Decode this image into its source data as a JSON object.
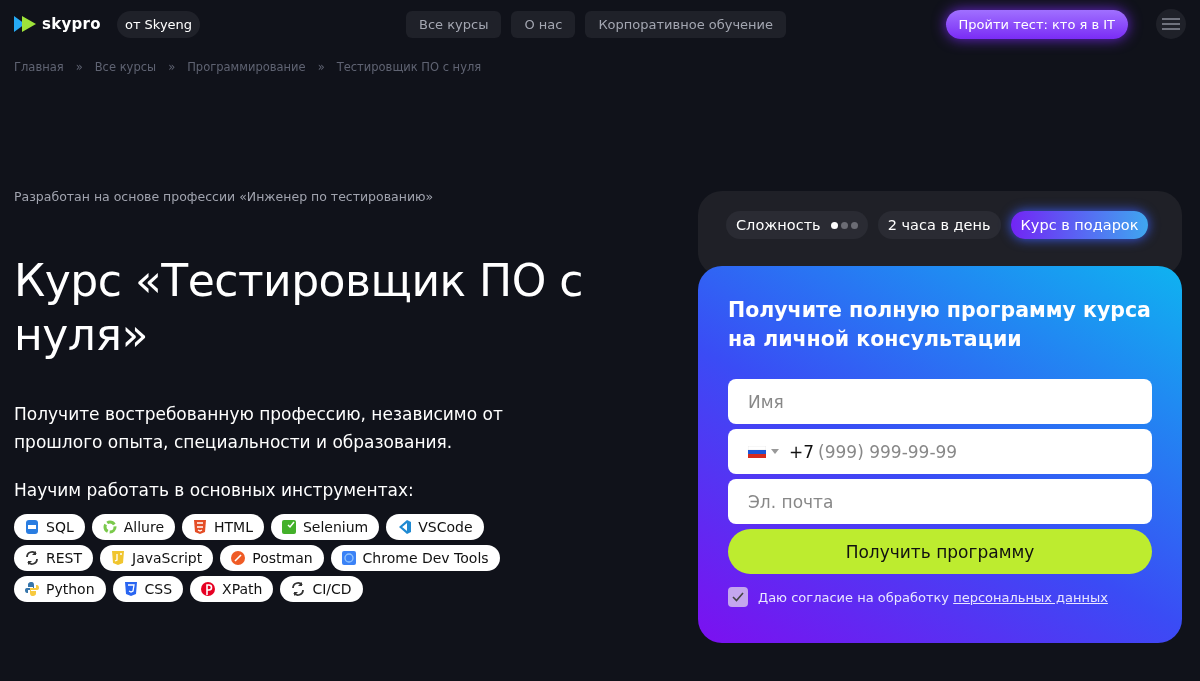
{
  "header": {
    "logo": "skypro",
    "logo_badge": "от Skyeng",
    "nav": [
      "Все курсы",
      "О нас",
      "Корпоративное обучение"
    ],
    "cta": "Пройти тест: кто я в IT"
  },
  "breadcrumbs": [
    "Главная",
    "Все курсы",
    "Программирование",
    "Тестировщик ПО с нуля"
  ],
  "breadcrumb_separator": "»",
  "hero": {
    "eyebrow": "Разработан на основе профессии «Инженер по тестированию»",
    "title": "Курс «Тестировщик ПО с нуля»",
    "subtitle": "Получите востребованную профессию, независимо от прошлого опыта, специальности и образования.",
    "tools_heading": "Научим работать в основных инструментах:",
    "tools": [
      {
        "label": "SQL",
        "kind": "sql"
      },
      {
        "label": "Allure",
        "kind": "allure"
      },
      {
        "label": "HTML",
        "kind": "html"
      },
      {
        "label": "Selenium",
        "kind": "selenium"
      },
      {
        "label": "VSCode",
        "kind": "vscode"
      },
      {
        "label": "REST",
        "kind": "cycle"
      },
      {
        "label": "JavaScript",
        "kind": "js"
      },
      {
        "label": "Postman",
        "kind": "postman"
      },
      {
        "label": "Chrome Dev Tools",
        "kind": "chrome"
      },
      {
        "label": "Python",
        "kind": "python"
      },
      {
        "label": "CSS",
        "kind": "css"
      },
      {
        "label": "XPath",
        "kind": "xpath"
      },
      {
        "label": "CI/CD",
        "kind": "cycle"
      }
    ]
  },
  "facts": {
    "difficulty_label": "Сложность",
    "stars": 1,
    "hours": "2 часа в день",
    "gift": "Курс в подарок"
  },
  "form": {
    "title": "Получите полную программу курса на личной консультации",
    "name": {
      "placeholder": "Имя"
    },
    "phone": {
      "prefix": "+7",
      "placeholder": "(999) 999-99-99"
    },
    "email": {
      "placeholder": "Эл. почта"
    },
    "submit": "Получить программу",
    "consent": {
      "checked": true,
      "text": "Даю согласие на обработку ",
      "link": "персональных данных"
    }
  }
}
